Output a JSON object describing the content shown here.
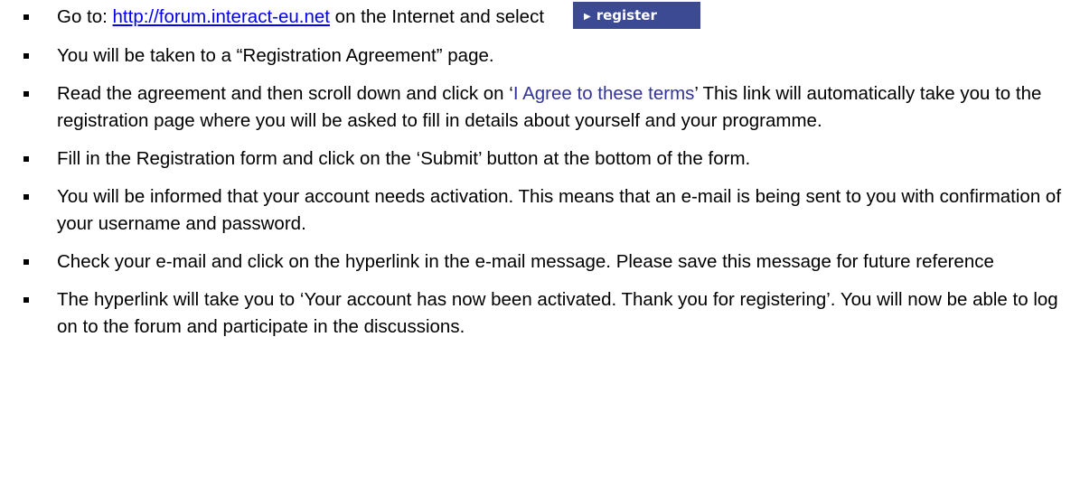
{
  "items": [
    {
      "prefix": "Go to: ",
      "link": "http://forum.interact-eu.net",
      "suffix": " on the Internet and select",
      "button_label": "register"
    },
    {
      "text": "You will be taken to a “Registration Agreement” page."
    },
    {
      "prefix": "Read the agreement and then scroll down and click on ‘",
      "highlight": "I Agree to these terms",
      "suffix": "’ This link will automatically take you to the registration page where you will be asked to fill in details about yourself and your programme."
    },
    {
      "text": "Fill in the Registration form and click on the ‘Submit’ button at the bottom of the form."
    },
    {
      "text": "You will be informed that your account needs activation. This means that an e-mail is being sent to you with confirmation of your username and password."
    },
    {
      "text": "Check your e-mail and click on the hyperlink in the e-mail message. Please save this message for future reference"
    },
    {
      "text": "The hyperlink will take you to ‘Your account has now been activated. Thank you for registering’. You will now be able to log on to the forum and participate in the discussions."
    }
  ],
  "icons": {
    "bullet": "square-bullet-icon",
    "button_arrow": "triangle-right-icon"
  },
  "colors": {
    "button_bg": "#3c4a93",
    "link": "#0000ee",
    "agree_text": "#333399"
  }
}
